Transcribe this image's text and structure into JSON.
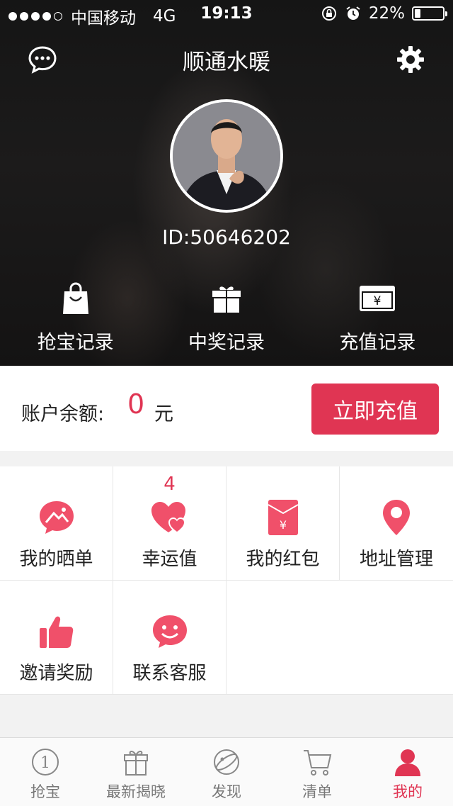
{
  "status_bar": {
    "carrier": "中国移动",
    "network": "4G",
    "time": "19:13",
    "battery_percent": "22%",
    "battery_level": 0.22
  },
  "header": {
    "title": "顺通水暖",
    "message_icon": "chat-bubble-icon",
    "settings_icon": "gear-icon"
  },
  "profile": {
    "user_id": "ID:50646202"
  },
  "records": [
    {
      "label": "抢宝记录",
      "icon": "shopping-bag-icon"
    },
    {
      "label": "中奖记录",
      "icon": "gift-icon"
    },
    {
      "label": "充值记录",
      "icon": "yen-card-icon"
    }
  ],
  "balance": {
    "label": "账户余额:",
    "amount": "0",
    "unit": "元",
    "recharge_button": "立即充值"
  },
  "grid": [
    {
      "label": "我的晒单",
      "icon": "photo-bubble-icon",
      "badge": ""
    },
    {
      "label": "幸运值",
      "icon": "hearts-icon",
      "badge": "4"
    },
    {
      "label": "我的红包",
      "icon": "red-envelope-icon",
      "badge": ""
    },
    {
      "label": "地址管理",
      "icon": "location-pin-icon",
      "badge": ""
    },
    {
      "label": "邀请奖励",
      "icon": "thumbs-up-icon",
      "badge": ""
    },
    {
      "label": "联系客服",
      "icon": "smiley-bubble-icon",
      "badge": ""
    }
  ],
  "tabbar": [
    {
      "label": "抢宝",
      "icon": "coin-one-icon",
      "active": false
    },
    {
      "label": "最新揭晓",
      "icon": "gift-box-icon",
      "active": false
    },
    {
      "label": "发现",
      "icon": "planet-icon",
      "active": false
    },
    {
      "label": "清单",
      "icon": "cart-icon",
      "active": false
    },
    {
      "label": "我的",
      "icon": "person-icon",
      "active": true
    }
  ],
  "colors": {
    "accent": "#e03553",
    "icon_pink": "#f0506a",
    "tab_inactive": "#777777"
  }
}
